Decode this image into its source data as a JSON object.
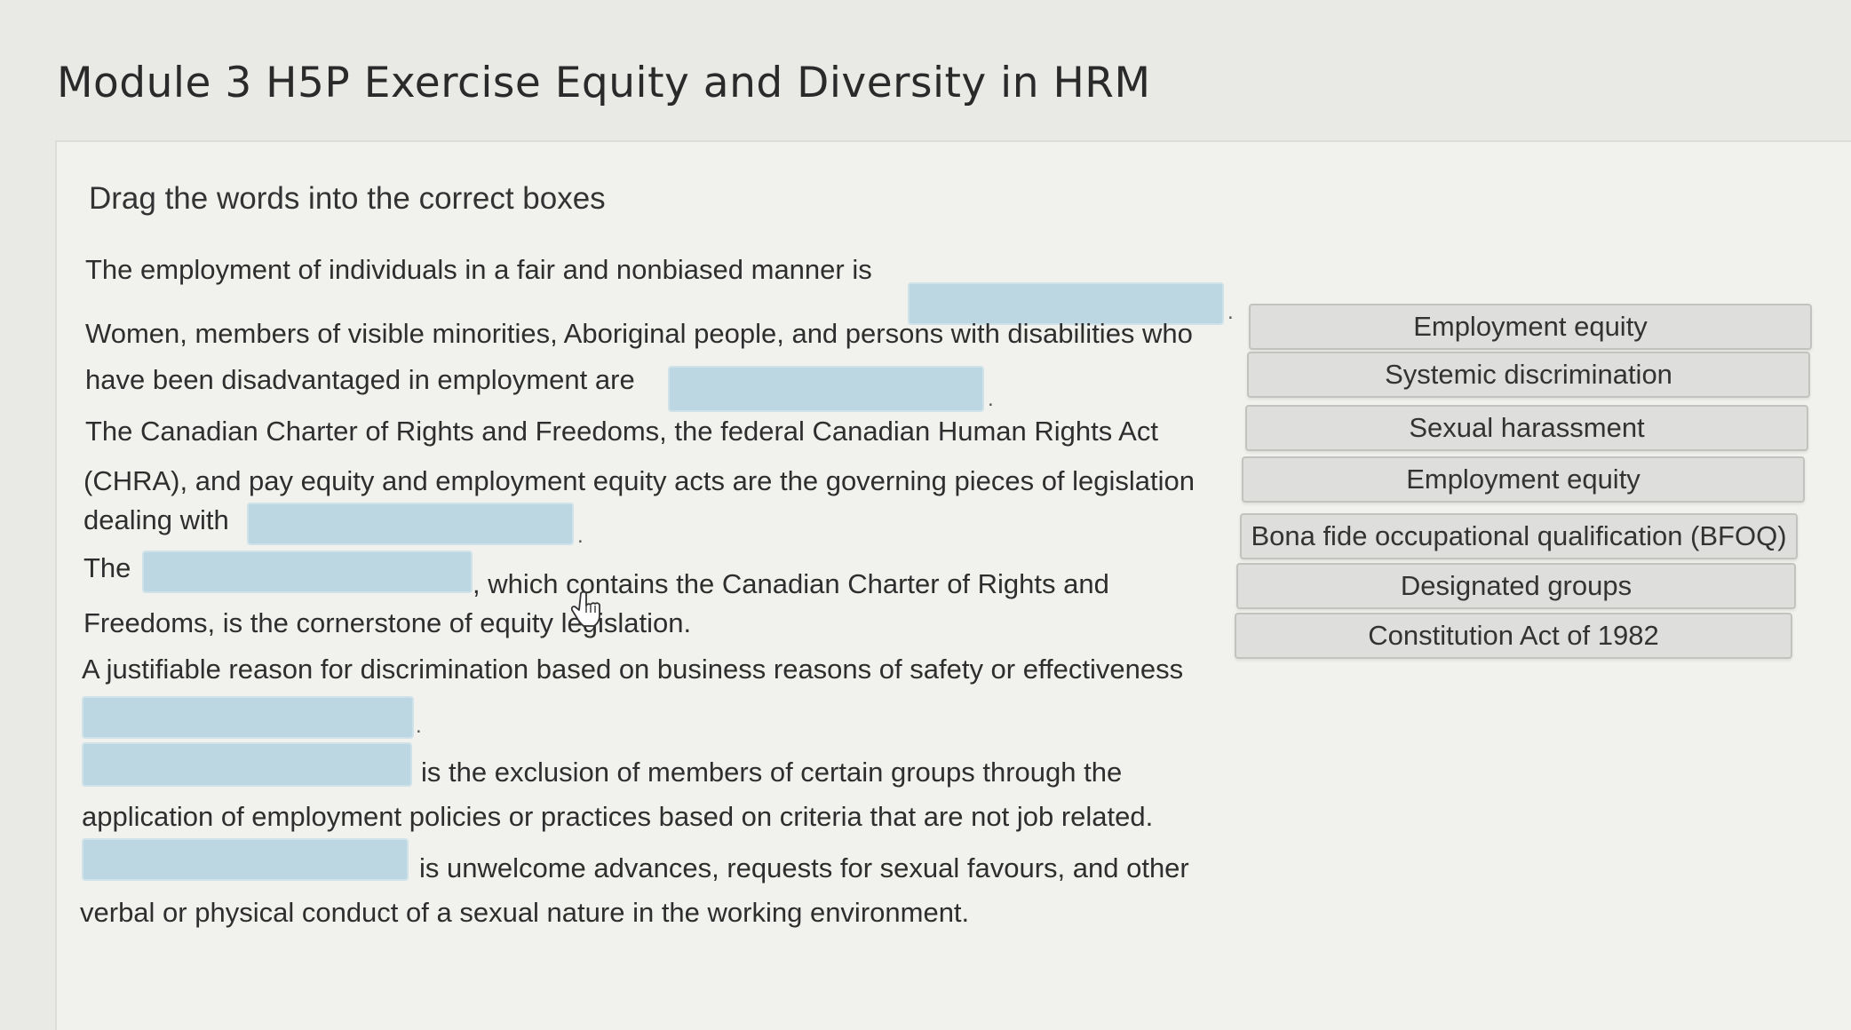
{
  "page": {
    "title": "Module 3 H5P Exercise Equity and Diversity in HRM",
    "instructions": "Drag the words into the correct boxes"
  },
  "sentences": {
    "s1_a": "The employment of individuals in a fair and nonbiased manner is",
    "s2_a": "Women, members of visible minorities, Aboriginal people, and persons with disabilities who",
    "s2_b": "have been disadvantaged in employment are",
    "s3_a": "The Canadian Charter of Rights and Freedoms, the federal Canadian Human Rights Act",
    "s3_b": "(CHRA), and pay equity and employment equity acts are the governing pieces of legislation",
    "s3_c": "dealing with",
    "s4_a": "The",
    "s4_b": ", which contains the Canadian Charter of Rights and",
    "s4_c": "Freedoms, is the cornerstone of equity legislation.",
    "s5_a": "A justifiable reason for discrimination based on business reasons of safety or effectiveness",
    "s6_a": "is the exclusion of members of certain groups through the",
    "s6_b": "application of employment policies or practices based on criteria that are not job related.",
    "s7_a": "is unwelcome advances, requests for sexual favours, and other",
    "s7_b": "verbal or physical conduct of a sexual nature in the working environment."
  },
  "punctuation": {
    "period": "."
  },
  "draggables": [
    "Employment equity",
    "Systemic discrimination",
    "Sexual harassment",
    "Employment equity",
    "Bona fide occupational qualification (BFOQ)",
    "Designated groups",
    "Constitution Act of 1982"
  ]
}
